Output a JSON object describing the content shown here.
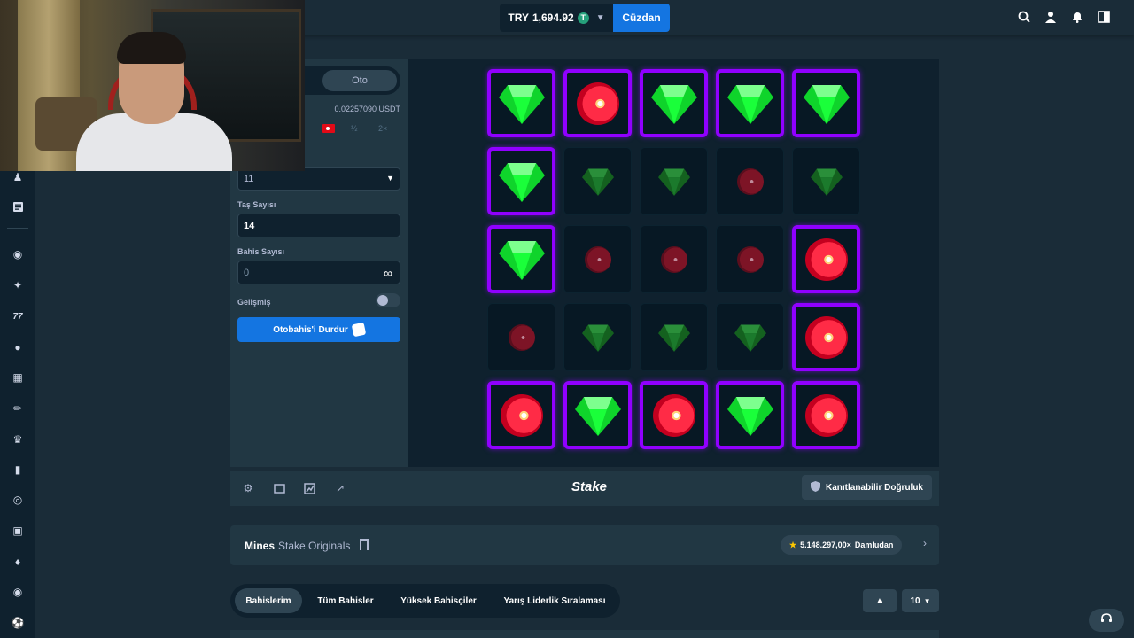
{
  "header": {
    "balance_currency": "TRY",
    "balance_amount": "1,694.92",
    "coin_symbol": "T",
    "wallet_label": "Cüzdan",
    "icons": [
      "search-icon",
      "user-icon",
      "bell-icon",
      "sidebar-toggle-icon"
    ]
  },
  "sidebar": {
    "icons": [
      "chess-piece-icon",
      "newspaper-icon",
      "casino-chip-icon",
      "sparkle-icon",
      "seven-icon",
      "fire-icon",
      "jersey-icon",
      "sword-icon",
      "crown-icon",
      "battery-icon",
      "target-icon",
      "gift-icon",
      "cards-icon",
      "tennis-icon",
      "football-icon"
    ]
  },
  "controls": {
    "mode_auto_label": "Oto",
    "amount_crypto": "0.02257090 USDT",
    "half_label": "½",
    "double_label": "2×",
    "mines_select_value": "11",
    "gems_label": "Taş Sayısı",
    "gems_value": "14",
    "bets_label": "Bahis Sayısı",
    "bets_value": "0",
    "advanced_label": "Gelişmiş",
    "advanced_enabled": false,
    "stop_button_label": "Otobahis'i Durdur"
  },
  "grid": {
    "rows": 5,
    "cols": 5,
    "tiles": [
      [
        "gem-revealed",
        "mine-revealed",
        "gem-revealed",
        "gem-revealed",
        "gem-revealed"
      ],
      [
        "gem-revealed",
        "gem-dim",
        "gem-dim",
        "mine-dim",
        "gem-dim"
      ],
      [
        "gem-revealed",
        "mine-dim",
        "mine-dim",
        "mine-dim",
        "mine-revealed"
      ],
      [
        "mine-dim",
        "gem-dim",
        "gem-dim",
        "gem-dim",
        "mine-revealed"
      ],
      [
        "mine-revealed",
        "gem-revealed",
        "mine-revealed",
        "gem-revealed",
        "mine-revealed"
      ]
    ]
  },
  "game_footer": {
    "icons": [
      "settings-icon",
      "theatre-icon",
      "stats-icon",
      "popout-icon"
    ],
    "logo_text": "Stake",
    "fairness_label": "Kanıtlanabilir Doğruluk"
  },
  "game_info": {
    "title": "Mines",
    "subtitle": "Stake Originals",
    "max_win": "5.148.297,00×",
    "max_win_suffix": "Damludan"
  },
  "bets": {
    "tabs": [
      "Bahislerim",
      "Tüm Bahisler",
      "Yüksek Bahisçiler",
      "Yarış Liderlik Sıralaması"
    ],
    "active_tab": 0,
    "page_size": "10"
  },
  "colors": {
    "accent_blue": "#1475e1",
    "tile_highlight": "#9000ff",
    "gem_green": "#1aff3a",
    "mine_red": "#ff2b46",
    "background": "#1a2c38",
    "panel": "#213743"
  }
}
